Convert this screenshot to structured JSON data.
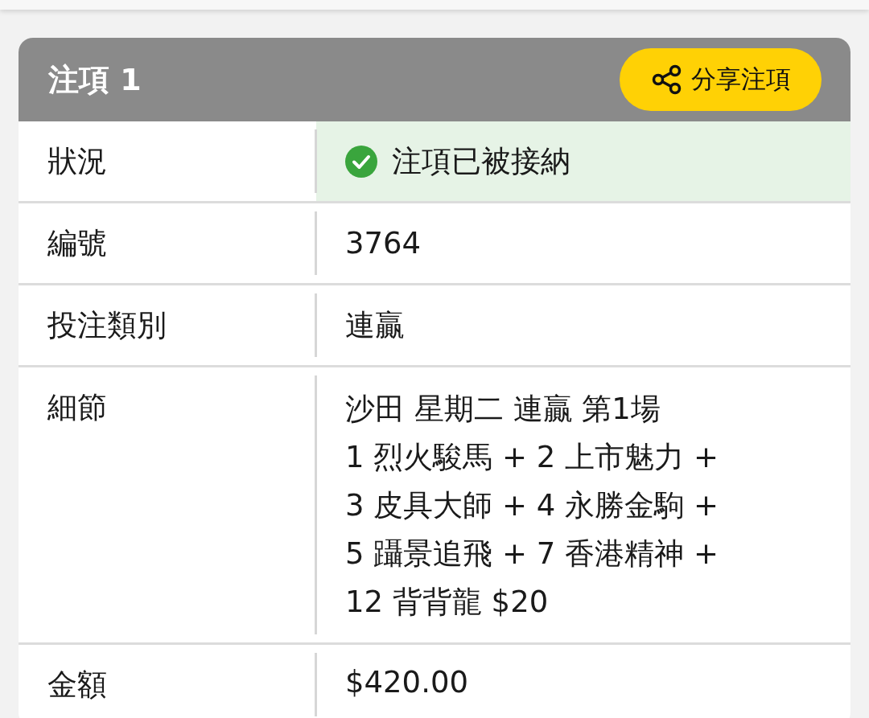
{
  "bet": {
    "title": "注項 1",
    "share_button": "分享注項",
    "rows": [
      {
        "kind": "status",
        "label": "狀況",
        "value": "注項已被接納",
        "accepted": true
      },
      {
        "kind": "text",
        "label": "編號",
        "value": "3764"
      },
      {
        "kind": "text",
        "label": "投注類別",
        "value": "連贏"
      },
      {
        "kind": "lines",
        "label": "細節",
        "lines": [
          "沙田 星期二 連贏 第1場",
          "1 烈火駿馬 + 2 上市魅力 +",
          "3 皮具大師 + 4 永勝金駒 +",
          "5 躡景追飛 + 7 香港精神 +",
          "12 背背龍 $20"
        ]
      },
      {
        "kind": "text",
        "label": "金額",
        "value": "$420.00"
      }
    ]
  }
}
